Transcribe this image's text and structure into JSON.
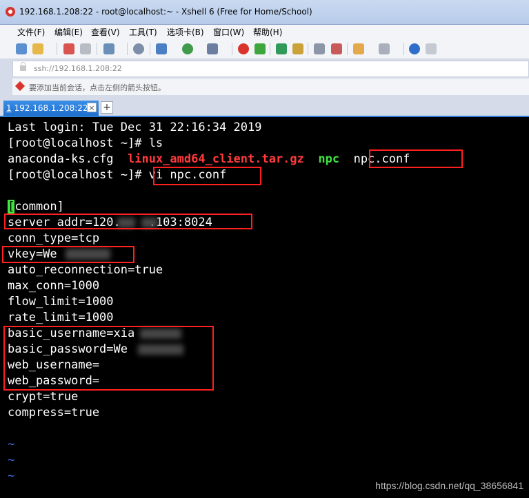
{
  "window": {
    "title": "192.168.1.208:22 - root@localhost:~ - Xshell 6 (Free for Home/School)"
  },
  "menu": [
    "文件(F)",
    "编辑(E)",
    "查看(V)",
    "工具(T)",
    "选项卡(B)",
    "窗口(W)",
    "帮助(H)"
  ],
  "address": {
    "value": "ssh://192.168.1.208:22"
  },
  "hint": {
    "text": "要添加当前会话，点击左侧的箭头按钮。"
  },
  "tabs": [
    {
      "num": "1",
      "label": "192.168.1.208:22"
    }
  ],
  "terminal": {
    "line1": "Last login: Tue Dec 31 22:16:34 2019",
    "line2": "[root@localhost ~]# ls",
    "ls": {
      "f1": "anaconda-ks.cfg",
      "f2": "linux_amd64_client.tar.gz",
      "f3": "npc",
      "f4": "npc.conf"
    },
    "prompt": "[root@localhost ~]#",
    "cmd": "vi npc.conf",
    "cursor": "[",
    "section": "common]",
    "conf": [
      "server_addr=120.    .103:8024",
      "conn_type=tcp",
      "vkey=We",
      "auto_reconnection=true",
      "max_conn=1000",
      "flow_limit=1000",
      "rate_limit=1000",
      "basic_username=xia",
      "basic_password=We",
      "web_username=",
      "web_password=",
      "crypt=true",
      "compress=true"
    ],
    "tilde": "~"
  },
  "watermark": "https://blog.csdn.net/qq_38656841",
  "colors": {
    "accent": "#2b7cd3",
    "highlight_box": "#ff2020",
    "ls_archive": "#ff3b3b",
    "ls_exec": "#3ee53e"
  }
}
